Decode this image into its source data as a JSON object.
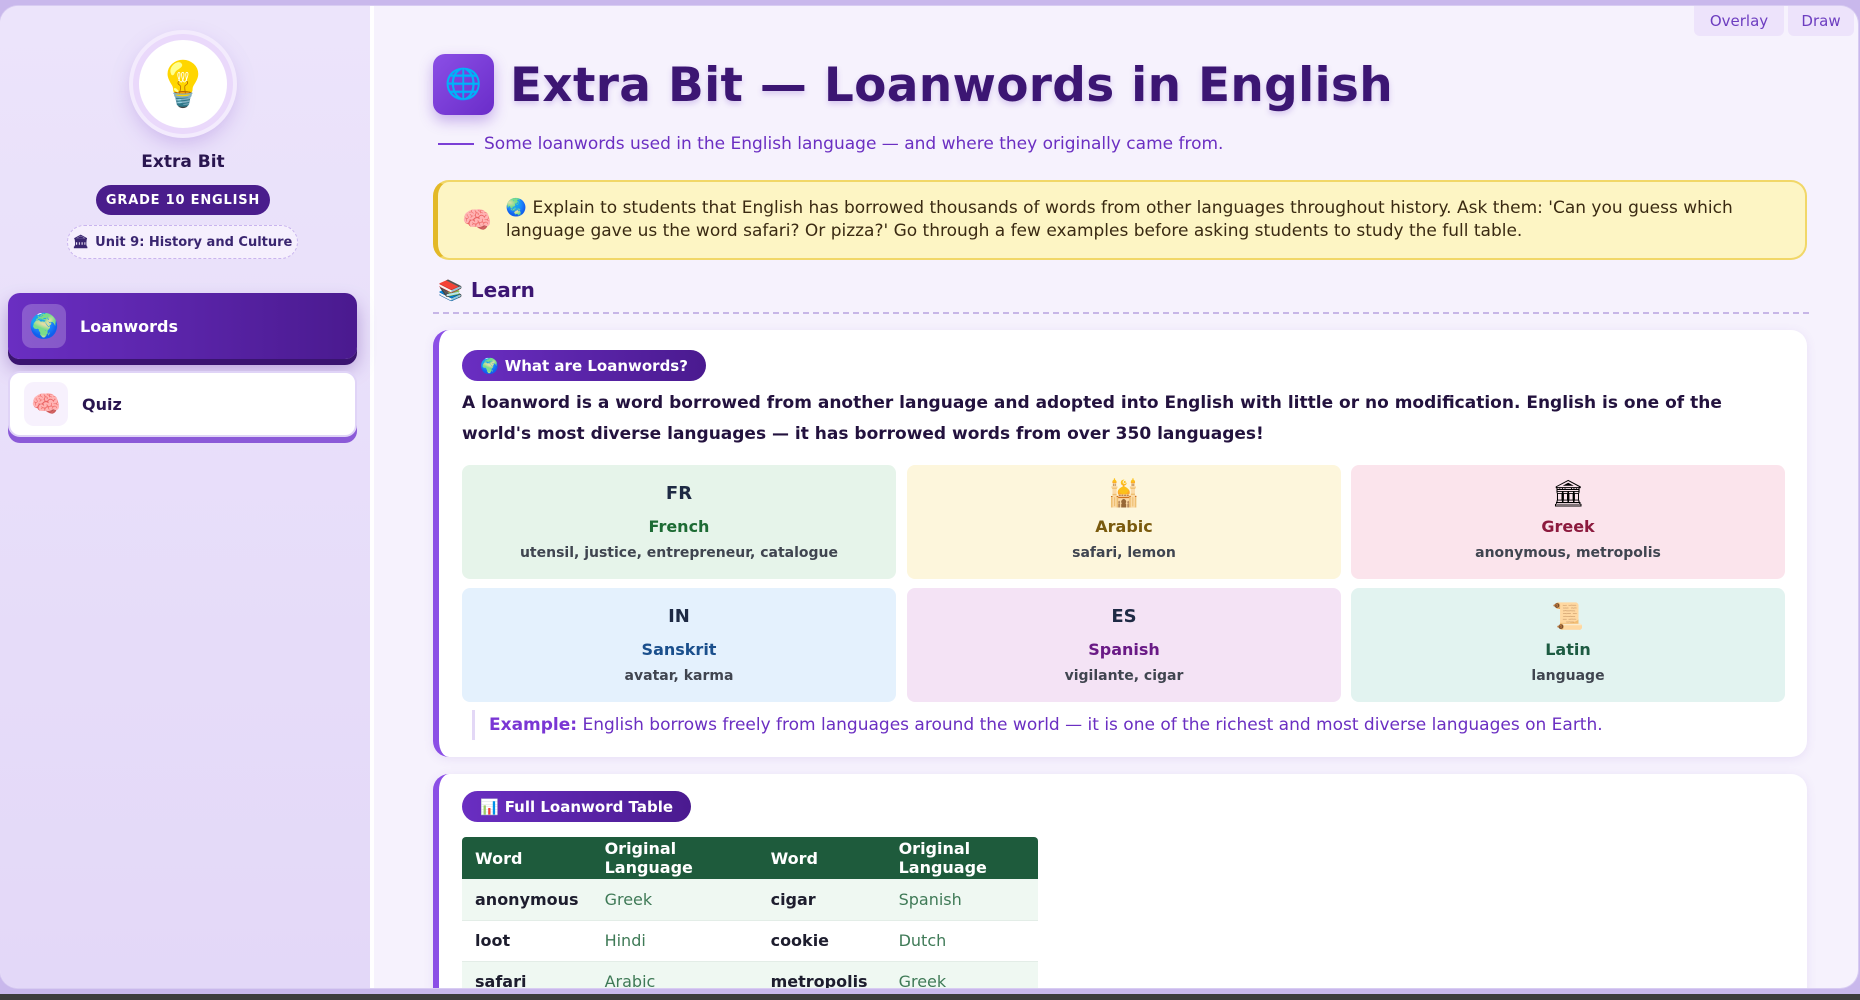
{
  "sidebar": {
    "icon": "lightbulb-icon",
    "title": "Extra Bit",
    "grade": "GRADE 10 ENGLISH",
    "unit": "Unit 9: History and Culture",
    "items": [
      {
        "label": "Loanwords",
        "icon": "globe-icon",
        "active": true
      },
      {
        "label": "Quiz",
        "icon": "brain-icon",
        "active": false
      }
    ]
  },
  "toolbar": {
    "overlay": "Overlay",
    "draw": "Draw"
  },
  "header": {
    "title": "Extra Bit — Loanwords in English",
    "subtitle": "Some loanwords used in the English language — and where they originally came from."
  },
  "note": {
    "text": "Explain to students that English has borrowed thousands of words from other languages throughout history. Ask them: 'Can you guess which language gave us the word safari? Or pizza?' Go through a few examples before asking students to study the full table."
  },
  "section": {
    "label": "Learn"
  },
  "what_card": {
    "pill": "What are Loanwords?",
    "intro_a": "A ",
    "intro_term": "loanword",
    "intro_b": " is a word borrowed from another language and adopted into English with little or no modification. English is one of the world's most diverse languages — it has borrowed words from over 350 languages!",
    "languages": [
      {
        "code": "FR",
        "name": "French",
        "words": "utensil, justice, entrepreneur, catalogue",
        "bg": "#e6f4ea",
        "color": "#1d6b34"
      },
      {
        "code": "🕌",
        "name": "Arabic",
        "words": "safari, lemon",
        "bg": "#fdf6dc",
        "color": "#7a5a0e"
      },
      {
        "code": "🏛",
        "name": "Greek",
        "words": "anonymous, metropolis",
        "bg": "#fbe4ec",
        "color": "#8c1a3e"
      },
      {
        "code": "IN",
        "name": "Sanskrit",
        "words": "avatar, karma",
        "bg": "#e4f1fd",
        "color": "#1a4f8c"
      },
      {
        "code": "ES",
        "name": "Spanish",
        "words": "vigilante, cigar",
        "bg": "#f4e3f5",
        "color": "#6a1a86"
      },
      {
        "code": "📜",
        "name": "Latin",
        "words": "language",
        "bg": "#e2f3f0",
        "color": "#1d5b42"
      }
    ],
    "example_label": "Example:",
    "example_text": " English borrows freely from languages around the world — it is one of the richest and most diverse languages on Earth."
  },
  "table_card": {
    "pill": "Full Loanword Table",
    "headers": [
      "Word",
      "Original Language",
      "Word",
      "Original Language"
    ],
    "rows": [
      [
        "anonymous",
        "Greek",
        "cigar",
        "Spanish"
      ],
      [
        "loot",
        "Hindi",
        "cookie",
        "Dutch"
      ],
      [
        "safari",
        "Arabic",
        "metropolis",
        "Greek"
      ]
    ]
  }
}
